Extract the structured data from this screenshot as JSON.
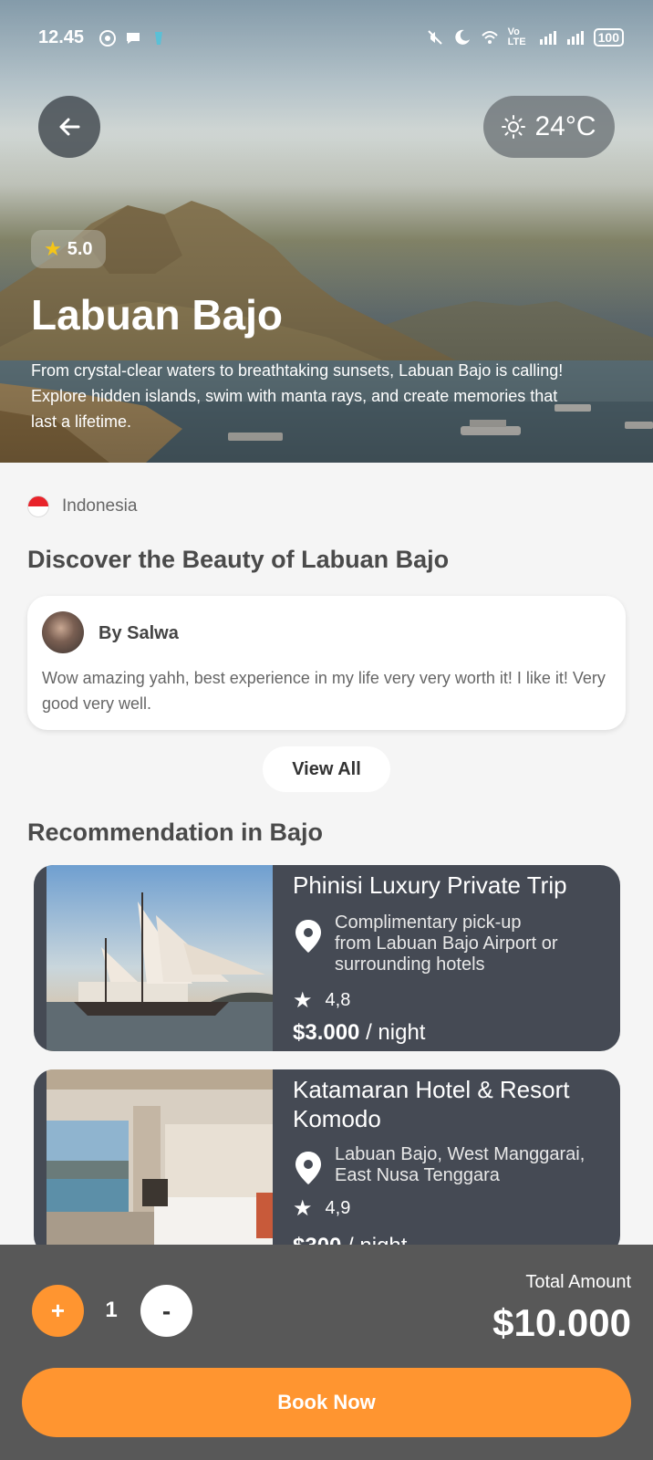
{
  "status_bar": {
    "time": "12.45",
    "battery": "100",
    "network": "Vo LTE"
  },
  "hero": {
    "rating": "5.0",
    "title": "Labuan Bajo",
    "description": "From crystal-clear waters to breathtaking sunsets, Labuan Bajo is calling! Explore hidden islands, swim with manta rays, and create memories that last a lifetime.",
    "temperature": "24°C"
  },
  "destination": {
    "country": "Indonesia",
    "section_title": "Discover the Beauty of Labuan Bajo"
  },
  "review": {
    "author": "By Salwa",
    "text": "Wow amazing yahh, best experience in my life very very worth it! I like it! Very good very well."
  },
  "view_all_label": "View All",
  "recommendation": {
    "title": "Recommendation in Bajo",
    "items": [
      {
        "name": "Phinisi Luxury Private Trip",
        "location": "Complimentary pick-up from Labuan Bajo Airport or surrounding hotels",
        "rating": "4,8",
        "price": "$3.000",
        "unit": " / night"
      },
      {
        "name": "Katamaran Hotel & Resort Komodo",
        "location": "Labuan Bajo, West Manggarai, East Nusa Tenggara",
        "rating": "4,9",
        "price": "$300",
        "unit": " / night"
      }
    ]
  },
  "booking": {
    "plus": "+",
    "quantity": "1",
    "minus": "-",
    "total_label": "Total Amount",
    "total_value": "$10.000",
    "book_label": "Book Now"
  },
  "colors": {
    "accent": "#ff9530",
    "card_dark": "#454a54",
    "bottom_bar": "#585858"
  }
}
